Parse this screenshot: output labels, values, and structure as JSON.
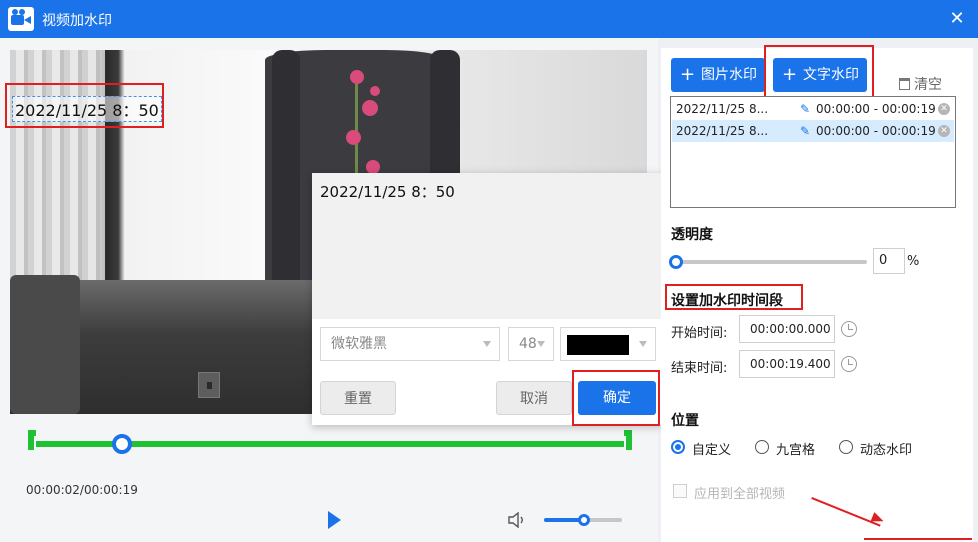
{
  "window": {
    "title": "视频加水印",
    "close_glyph": "✕"
  },
  "preview": {
    "watermark_text": "2022/11/25 8：50",
    "time_readout": "00:00:02/00:00:19"
  },
  "editor_popup": {
    "text": "2022/11/25 8：50",
    "font": "微软雅黑",
    "font_size": "48",
    "color": "#000000",
    "reset_label": "重置",
    "cancel_label": "取消",
    "confirm_label": "确定"
  },
  "toolbar": {
    "image_watermark_label": "图片水印",
    "text_watermark_label": "文字水印",
    "clear_label": "清空",
    "plus_glyph": "+"
  },
  "watermark_list": [
    {
      "name": "2022/11/25 8...",
      "range": "00:00:00  -  00:00:19",
      "selected": false
    },
    {
      "name": "2022/11/25 8...",
      "range": "00:00:00  -  00:00:19",
      "selected": true
    }
  ],
  "icons": {
    "edit_glyph": "✎",
    "delete_glyph": "✕"
  },
  "opacity": {
    "label": "透明度",
    "value": "0",
    "unit": "%"
  },
  "time_range": {
    "label": "设置加水印时间段",
    "start_label": "开始时间:",
    "start_value": "00:00:00.000",
    "end_label": "结束时间:",
    "end_value": "00:00:19.400"
  },
  "position": {
    "label": "位置",
    "options": [
      {
        "label": "自定义",
        "selected": true
      },
      {
        "label": "九宫格",
        "selected": false
      },
      {
        "label": "动态水印",
        "selected": false
      }
    ]
  },
  "apply_all": {
    "label": "应用到全部视频",
    "enabled": false
  },
  "colors": {
    "accent": "#1a73e8",
    "track": "#1fc233",
    "highlight": "#e02020"
  }
}
